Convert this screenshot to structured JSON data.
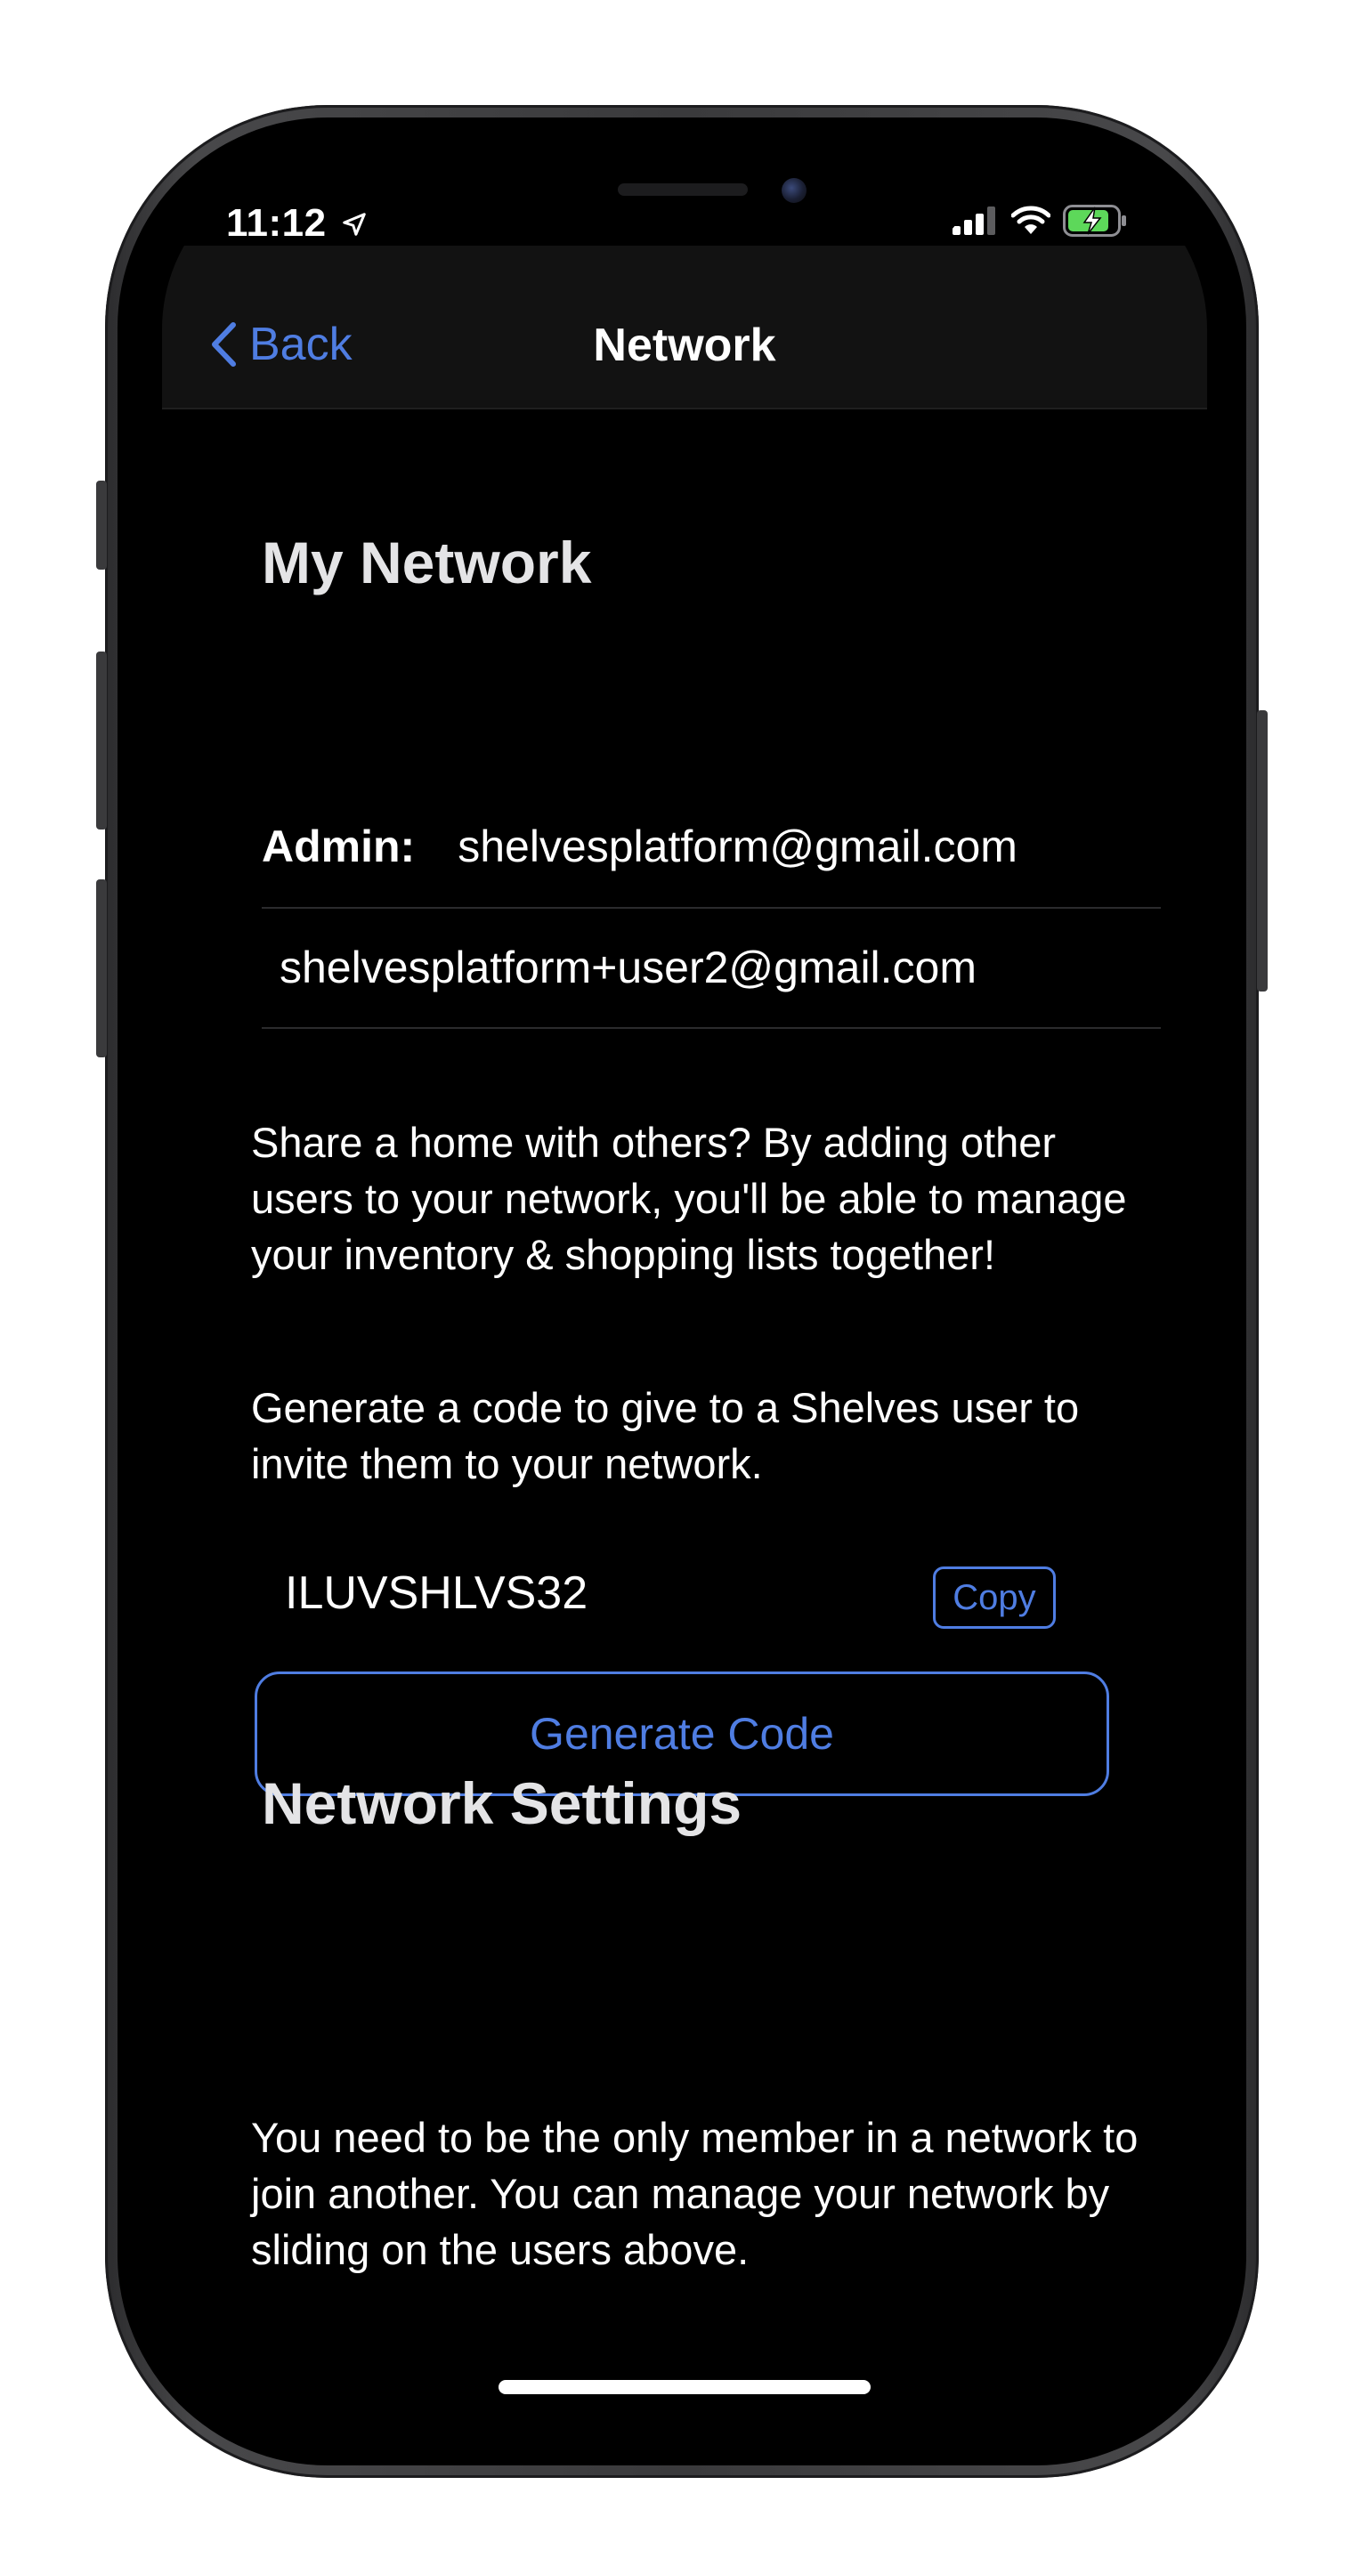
{
  "status_bar": {
    "time": "11:12",
    "icons": [
      "location-arrow-icon",
      "cellular-signal-icon",
      "wifi-icon",
      "battery-charging-icon"
    ]
  },
  "nav": {
    "back_label": "Back",
    "title": "Network"
  },
  "my_network": {
    "title": "My Network",
    "admin_label": "Admin:",
    "admin_email": "shelvesplatform@gmail.com",
    "members": [
      "shelvesplatform+user2@gmail.com"
    ]
  },
  "share_description": "Share a home with others? By adding other users to your network, you'll be able to manage your inventory & shopping lists together!",
  "generate_description": "Generate a code to give to a Shelves user to invite them to your network.",
  "invite": {
    "code": "ILUVSHLVS32",
    "copy_label": "Copy",
    "generate_label": "Generate Code"
  },
  "network_settings": {
    "title": "Network Settings",
    "description": "You need to be the only member in a network to join another. You can manage your network by sliding on the users above."
  },
  "colors": {
    "accent": "#4f7de2",
    "background": "#000000",
    "battery": "#5dd85a"
  }
}
